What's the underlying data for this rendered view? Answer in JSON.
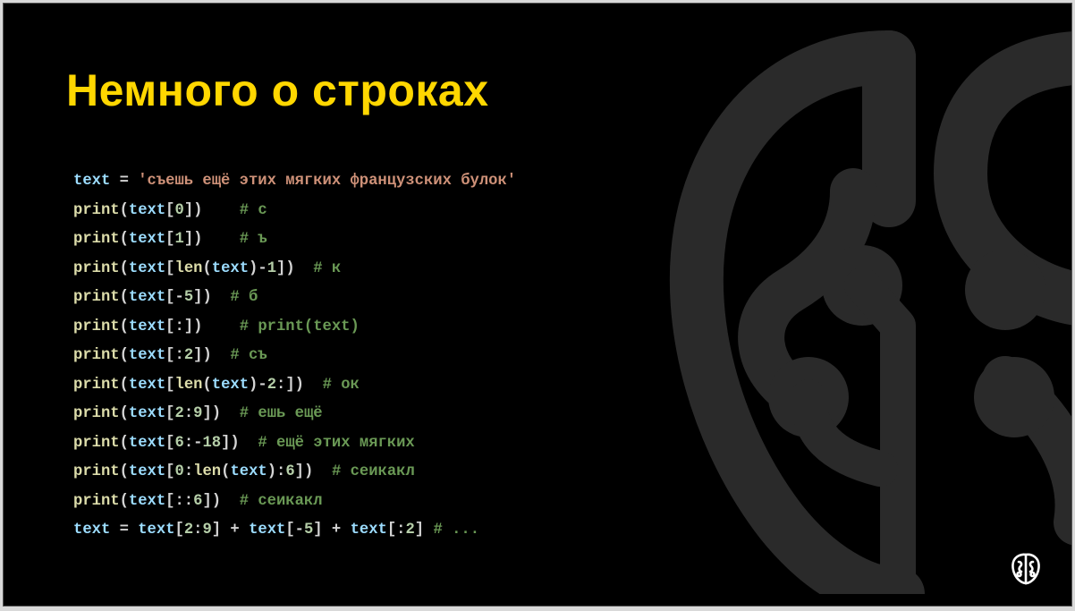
{
  "slide": {
    "title": "Немного о строках",
    "code_lines": [
      [
        {
          "t": "text",
          "c": "var"
        },
        {
          "t": " = ",
          "c": "op"
        },
        {
          "t": "'съешь ещё этих мягких французских булок'",
          "c": "str"
        }
      ],
      [
        {
          "t": "print",
          "c": "fn"
        },
        {
          "t": "(",
          "c": "op"
        },
        {
          "t": "text",
          "c": "var"
        },
        {
          "t": "[",
          "c": "op"
        },
        {
          "t": "0",
          "c": "num"
        },
        {
          "t": "])    ",
          "c": "op"
        },
        {
          "t": "# с",
          "c": "com"
        }
      ],
      [
        {
          "t": "print",
          "c": "fn"
        },
        {
          "t": "(",
          "c": "op"
        },
        {
          "t": "text",
          "c": "var"
        },
        {
          "t": "[",
          "c": "op"
        },
        {
          "t": "1",
          "c": "num"
        },
        {
          "t": "])    ",
          "c": "op"
        },
        {
          "t": "# ъ",
          "c": "com"
        }
      ],
      [
        {
          "t": "print",
          "c": "fn"
        },
        {
          "t": "(",
          "c": "op"
        },
        {
          "t": "text",
          "c": "var"
        },
        {
          "t": "[",
          "c": "op"
        },
        {
          "t": "len",
          "c": "fn"
        },
        {
          "t": "(",
          "c": "op"
        },
        {
          "t": "text",
          "c": "var"
        },
        {
          "t": ")-",
          "c": "op"
        },
        {
          "t": "1",
          "c": "num"
        },
        {
          "t": "])  ",
          "c": "op"
        },
        {
          "t": "# к",
          "c": "com"
        }
      ],
      [
        {
          "t": "print",
          "c": "fn"
        },
        {
          "t": "(",
          "c": "op"
        },
        {
          "t": "text",
          "c": "var"
        },
        {
          "t": "[-",
          "c": "op"
        },
        {
          "t": "5",
          "c": "num"
        },
        {
          "t": "])  ",
          "c": "op"
        },
        {
          "t": "# б",
          "c": "com"
        }
      ],
      [
        {
          "t": "print",
          "c": "fn"
        },
        {
          "t": "(",
          "c": "op"
        },
        {
          "t": "text",
          "c": "var"
        },
        {
          "t": "[:])    ",
          "c": "op"
        },
        {
          "t": "# print(text)",
          "c": "com"
        }
      ],
      [
        {
          "t": "print",
          "c": "fn"
        },
        {
          "t": "(",
          "c": "op"
        },
        {
          "t": "text",
          "c": "var"
        },
        {
          "t": "[:",
          "c": "op"
        },
        {
          "t": "2",
          "c": "num"
        },
        {
          "t": "])  ",
          "c": "op"
        },
        {
          "t": "# съ",
          "c": "com"
        }
      ],
      [
        {
          "t": "print",
          "c": "fn"
        },
        {
          "t": "(",
          "c": "op"
        },
        {
          "t": "text",
          "c": "var"
        },
        {
          "t": "[",
          "c": "op"
        },
        {
          "t": "len",
          "c": "fn"
        },
        {
          "t": "(",
          "c": "op"
        },
        {
          "t": "text",
          "c": "var"
        },
        {
          "t": ")-",
          "c": "op"
        },
        {
          "t": "2",
          "c": "num"
        },
        {
          "t": ":])  ",
          "c": "op"
        },
        {
          "t": "# ок",
          "c": "com"
        }
      ],
      [
        {
          "t": "print",
          "c": "fn"
        },
        {
          "t": "(",
          "c": "op"
        },
        {
          "t": "text",
          "c": "var"
        },
        {
          "t": "[",
          "c": "op"
        },
        {
          "t": "2",
          "c": "num"
        },
        {
          "t": ":",
          "c": "op"
        },
        {
          "t": "9",
          "c": "num"
        },
        {
          "t": "])  ",
          "c": "op"
        },
        {
          "t": "# ешь ещё",
          "c": "com"
        }
      ],
      [
        {
          "t": "print",
          "c": "fn"
        },
        {
          "t": "(",
          "c": "op"
        },
        {
          "t": "text",
          "c": "var"
        },
        {
          "t": "[",
          "c": "op"
        },
        {
          "t": "6",
          "c": "num"
        },
        {
          "t": ":-",
          "c": "op"
        },
        {
          "t": "18",
          "c": "num"
        },
        {
          "t": "])  ",
          "c": "op"
        },
        {
          "t": "# ещё этих мягких",
          "c": "com"
        }
      ],
      [
        {
          "t": "print",
          "c": "fn"
        },
        {
          "t": "(",
          "c": "op"
        },
        {
          "t": "text",
          "c": "var"
        },
        {
          "t": "[",
          "c": "op"
        },
        {
          "t": "0",
          "c": "num"
        },
        {
          "t": ":",
          "c": "op"
        },
        {
          "t": "len",
          "c": "fn"
        },
        {
          "t": "(",
          "c": "op"
        },
        {
          "t": "text",
          "c": "var"
        },
        {
          "t": "):",
          "c": "op"
        },
        {
          "t": "6",
          "c": "num"
        },
        {
          "t": "])  ",
          "c": "op"
        },
        {
          "t": "# сеикакл",
          "c": "com"
        }
      ],
      [
        {
          "t": "print",
          "c": "fn"
        },
        {
          "t": "(",
          "c": "op"
        },
        {
          "t": "text",
          "c": "var"
        },
        {
          "t": "[::",
          "c": "op"
        },
        {
          "t": "6",
          "c": "num"
        },
        {
          "t": "])  ",
          "c": "op"
        },
        {
          "t": "# сеикакл",
          "c": "com"
        }
      ],
      [
        {
          "t": "text",
          "c": "var"
        },
        {
          "t": " = ",
          "c": "op"
        },
        {
          "t": "text",
          "c": "var"
        },
        {
          "t": "[",
          "c": "op"
        },
        {
          "t": "2",
          "c": "num"
        },
        {
          "t": ":",
          "c": "op"
        },
        {
          "t": "9",
          "c": "num"
        },
        {
          "t": "] + ",
          "c": "op"
        },
        {
          "t": "text",
          "c": "var"
        },
        {
          "t": "[-",
          "c": "op"
        },
        {
          "t": "5",
          "c": "num"
        },
        {
          "t": "] + ",
          "c": "op"
        },
        {
          "t": "text",
          "c": "var"
        },
        {
          "t": "[:",
          "c": "op"
        },
        {
          "t": "2",
          "c": "num"
        },
        {
          "t": "] ",
          "c": "op"
        },
        {
          "t": "# ...",
          "c": "com"
        }
      ]
    ]
  },
  "colors": {
    "background": "#000000",
    "title": "#ffd700",
    "variable": "#9cdcfe",
    "function": "#dcdcaa",
    "operator": "#d4d4d4",
    "string": "#ce9178",
    "number": "#b5cea8",
    "comment": "#6a9955",
    "watermark": "#2a2a2a"
  },
  "icons": {
    "background_logo": "brain-logo-icon",
    "corner_logo": "brain-logo-icon"
  }
}
